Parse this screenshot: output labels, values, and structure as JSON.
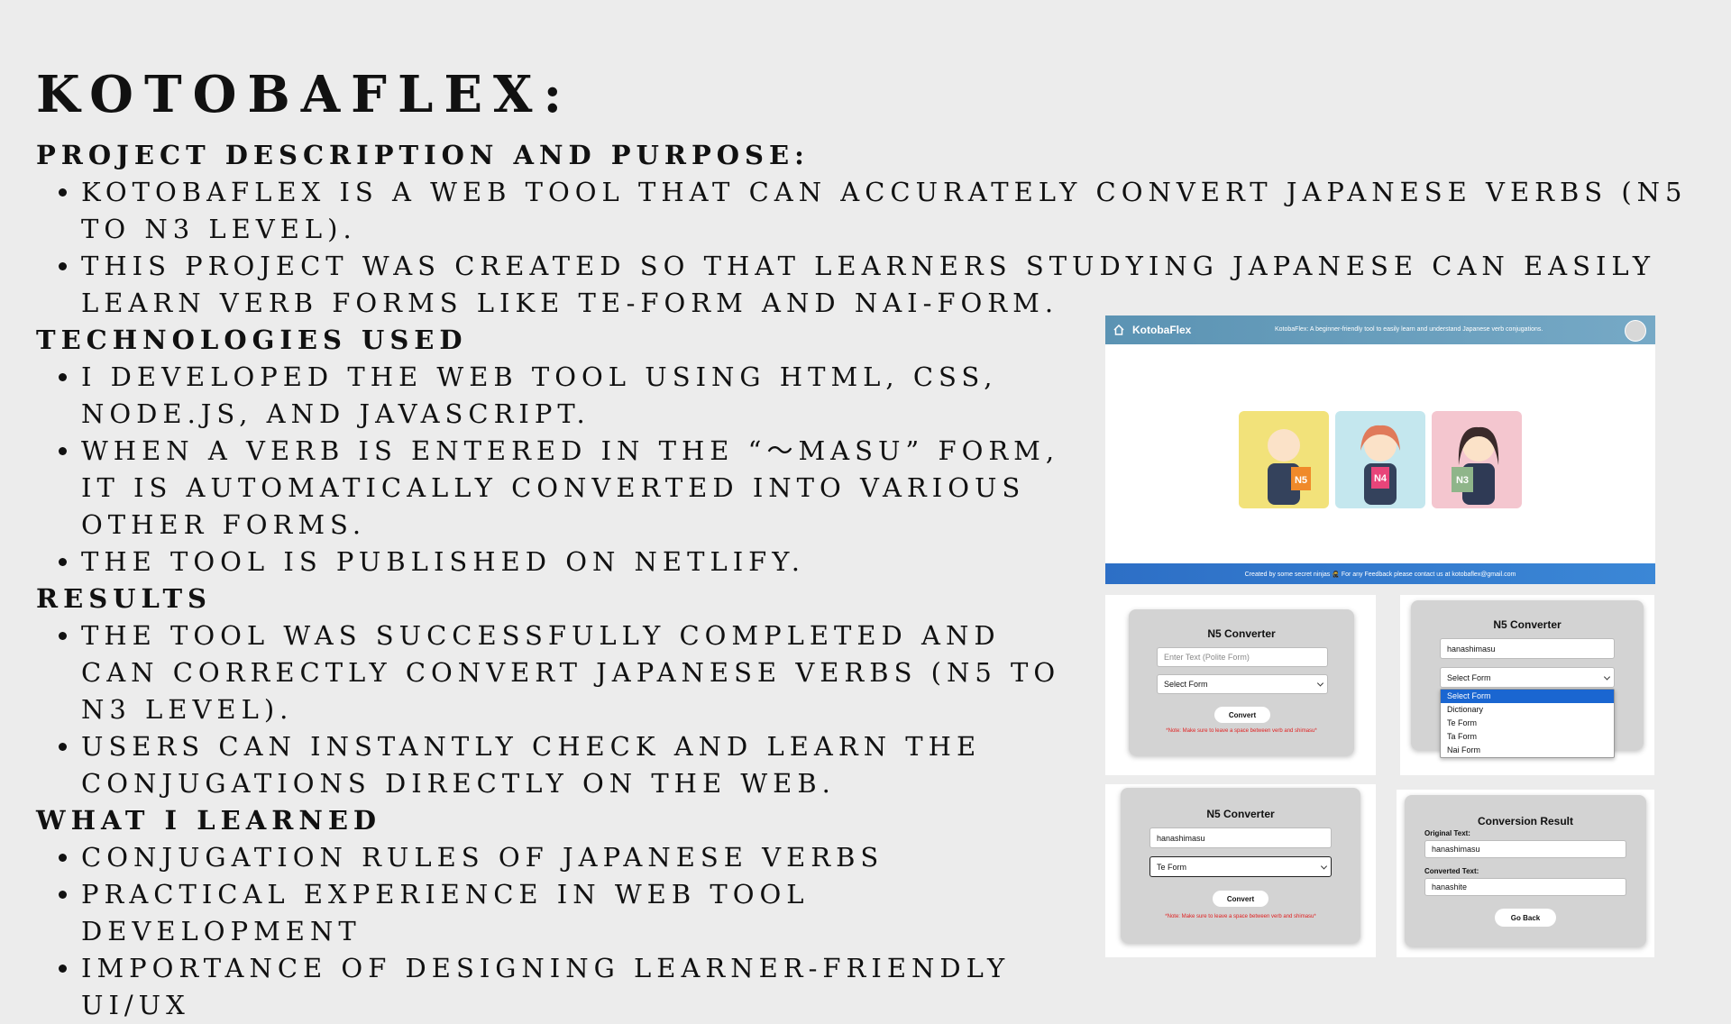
{
  "slide": {
    "title": "KOTOBAFLEX:",
    "sections": [
      {
        "heading": "PROJECT DESCRIPTION AND PURPOSE:",
        "bullets": [
          "KOTOBAFLEX IS A WEB TOOL THAT CAN ACCURATELY CONVERT JAPANESE VERBS (N5 TO N3 LEVEL).",
          "THIS PROJECT WAS CREATED SO THAT LEARNERS STUDYING JAPANESE CAN EASILY LEARN VERB FORMS LIKE TE-FORM AND NAI-FORM."
        ]
      },
      {
        "heading": "TECHNOLOGIES USED",
        "bullets": [
          "I DEVELOPED THE WEB TOOL USING HTML, CSS, NODE.JS, AND JAVASCRIPT.",
          "WHEN A VERB IS ENTERED IN THE “〜MASU” FORM, IT IS AUTOMATICALLY CONVERTED INTO VARIOUS OTHER FORMS.",
          "THE TOOL IS PUBLISHED ON NETLIFY."
        ]
      },
      {
        "heading": "RESULTS",
        "bullets": [
          "THE TOOL WAS SUCCESSFULLY COMPLETED AND CAN CORRECTLY CONVERT JAPANESE VERBS (N5 TO N3 LEVEL).",
          "USERS CAN INSTANTLY CHECK AND LEARN THE CONJUGATIONS DIRECTLY ON THE WEB."
        ]
      },
      {
        "heading": "WHAT I LEARNED",
        "bullets": [
          "CONJUGATION RULES OF JAPANESE VERBS",
          "PRACTICAL EXPERIENCE IN WEB TOOL DEVELOPMENT",
          "IMPORTANCE OF DESIGNING LEARNER-FRIENDLY UI/UX"
        ]
      }
    ]
  },
  "app": {
    "brand": "KotobaFlex",
    "tagline": "KotobaFlex: A beginner-friendly tool to easily learn and understand Japanese verb conjugations.",
    "footer": "Created by some secret ninjas 🥷 For any Feedback please contact us at kotobaflex@gmail.com",
    "cards": [
      {
        "label": "N5",
        "color": "#f2e27a"
      },
      {
        "label": "N4",
        "color": "#c4e7ee"
      },
      {
        "label": "N3",
        "color": "#f4c6cf"
      }
    ],
    "icons": [
      "home-icon",
      "user-avatar-icon"
    ]
  },
  "converter_empty": {
    "title": "N5 Converter",
    "input_placeholder": "Enter Text (Polite Form)",
    "select_value": "Select Form",
    "button": "Convert",
    "note": "*Note: Make sure to leave a space between verb and shimasu*"
  },
  "converter_dropdown": {
    "title": "N5 Converter",
    "input_value": "hanashimasu",
    "select_value": "Select Form",
    "options": [
      "Select Form",
      "Dictionary",
      "Te Form",
      "Ta Form",
      "Nai Form"
    ],
    "selected_option": "Select Form"
  },
  "converter_filled": {
    "title": "N5 Converter",
    "input_value": "hanashimasu",
    "select_value": "Te Form",
    "button": "Convert",
    "note": "*Note: Make sure to leave a space between verb and shimasu*"
  },
  "result": {
    "title": "Conversion Result",
    "original_label": "Original Text:",
    "original_value": "hanashimasu",
    "converted_label": "Converted Text:",
    "converted_value": "hanashite",
    "button": "Go Back"
  },
  "colors": {
    "background": "#ececec",
    "header_gradient_start": "#5b93b3",
    "footer_blue": "#2d6fc6",
    "dropdown_selected": "#1a66d1",
    "note_red": "#e02020"
  }
}
